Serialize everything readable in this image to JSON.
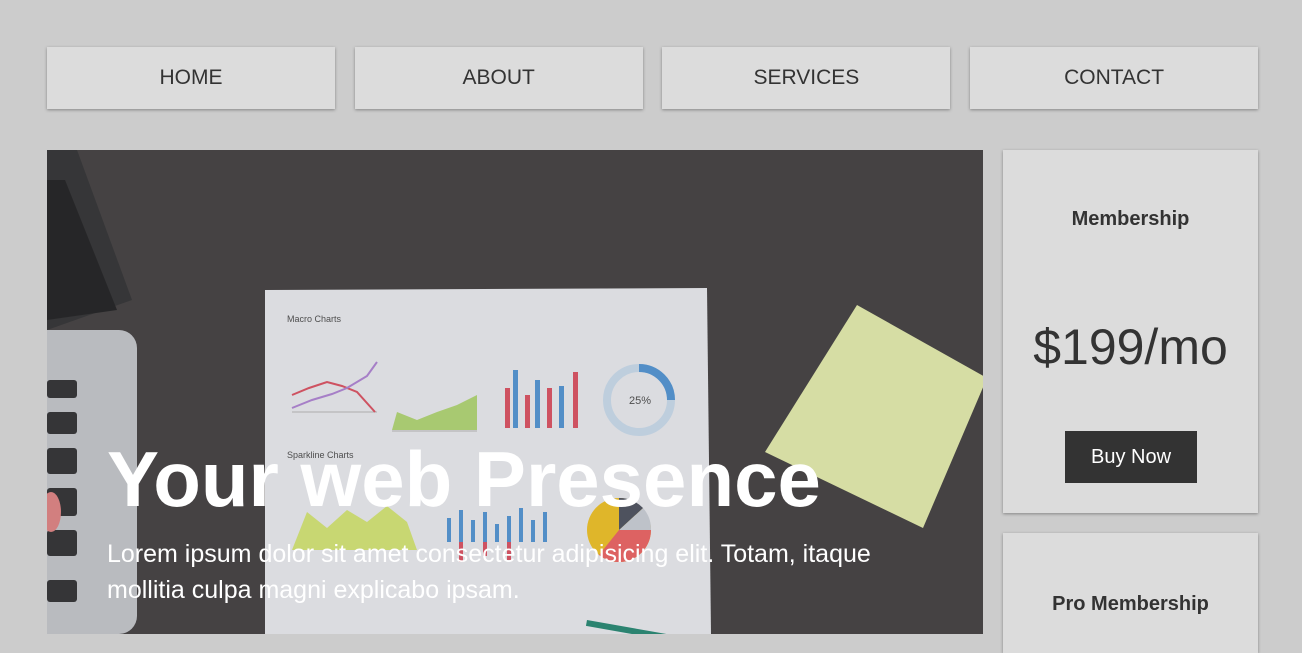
{
  "nav": {
    "items": [
      {
        "label": "HOME"
      },
      {
        "label": "ABOUT"
      },
      {
        "label": "SERVICES"
      },
      {
        "label": "CONTACT"
      }
    ]
  },
  "hero": {
    "title": "Your web Presence",
    "text": "Lorem ipsum dolor sit amet consectetur adipisicing elit. Totam, itaque mollitia culpa magni explicabo ipsam.",
    "image_caption_main": "Macro Charts",
    "image_caption_secondary": "Sparkline Charts",
    "image_donut_label": "25%"
  },
  "pricing": [
    {
      "title": "Membership",
      "price": "$199/mo",
      "button": "Buy Now"
    },
    {
      "title": "Pro Membership"
    }
  ],
  "colors": {
    "page_bg": "#cccccc",
    "card_bg": "#dcdcdc",
    "button_bg": "#333333",
    "text": "#333333"
  }
}
